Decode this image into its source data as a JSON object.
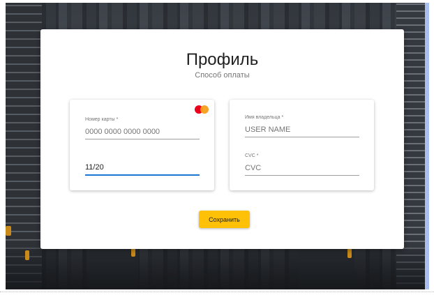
{
  "page": {
    "title": "Профиль",
    "subtitle": "Способ оплаты"
  },
  "card_details": {
    "brand_icon": "mastercard-icon",
    "card_number": {
      "label": "Номер карты",
      "required_mark": "*",
      "placeholder": "0000 0000 0000 0000",
      "value": ""
    },
    "expiry": {
      "value": "11/20"
    }
  },
  "holder_details": {
    "holder_name": {
      "label": "Имя владельца",
      "required_mark": "*",
      "placeholder": "USER NAME",
      "value": ""
    },
    "cvc": {
      "label": "CVC",
      "required_mark": "*",
      "placeholder": "CVC",
      "value": ""
    }
  },
  "actions": {
    "save_label": "Сохранить"
  },
  "colors": {
    "accent_button": "#ffc107",
    "focus_underline": "#1976d2",
    "mastercard_red": "#eb001b",
    "mastercard_orange": "#f79e1b"
  }
}
